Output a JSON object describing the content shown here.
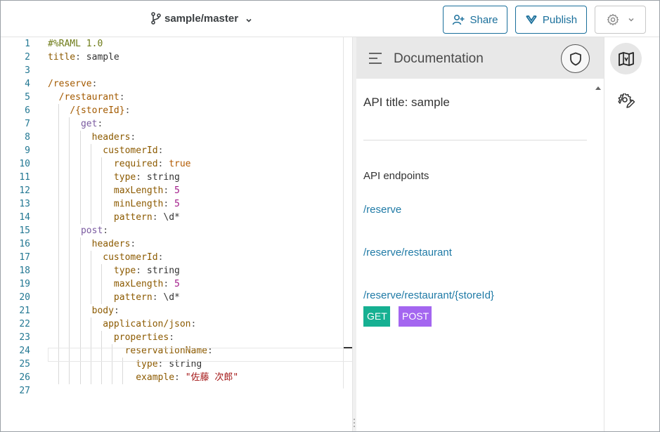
{
  "topbar": {
    "branch_label": "sample/master",
    "share_label": "Share",
    "publish_label": "Publish",
    "icons": {
      "branch": "git-branch-icon",
      "branch_dropdown": "chevron-down-icon",
      "share": "add-user-icon",
      "publish": "publish-icon",
      "settings": "gear-icon",
      "settings_dropdown": "chevron-down-icon"
    }
  },
  "editor": {
    "line_numbers": [
      "1",
      "2",
      "3",
      "4",
      "5",
      "6",
      "7",
      "8",
      "9",
      "10",
      "11",
      "12",
      "13",
      "14",
      "15",
      "16",
      "17",
      "18",
      "19",
      "20",
      "21",
      "22",
      "23",
      "24",
      "25",
      "26",
      "27"
    ],
    "lines": [
      "#%RAML 1.0",
      "title: sample",
      "",
      "/reserve:",
      "  /restaurant:",
      "    /{storeId}:",
      "      get:",
      "        headers:",
      "          customerId:",
      "            required: true",
      "            type: string",
      "            maxLength: 5",
      "            minLength: 5",
      "            pattern: \\d*",
      "      post:",
      "        headers:",
      "          customerId:",
      "            type: string",
      "            maxLength: 5",
      "            pattern: \\d*",
      "        body:",
      "          application/json:",
      "            properties:",
      "              reservationName:",
      "                type: string",
      "                example: \"佐藤 次郎\"",
      ""
    ],
    "colors": {
      "line_number": "#237893",
      "comment": "#6e7b18",
      "key": "#8c5a00",
      "bool": "#b35a00",
      "number": "#a21d8a"
    }
  },
  "docs": {
    "header_title": "Documentation",
    "api_title": "API title: sample",
    "endpoints_heading": "API endpoints",
    "endpoints": [
      "/reserve",
      "/reserve/restaurant",
      "/reserve/restaurant/{storeId}"
    ],
    "methods": [
      "GET",
      "POST"
    ],
    "icons": {
      "menu": "hamburger-menu-icon",
      "shield": "shield-icon"
    },
    "colors": {
      "link": "#1f7aa6",
      "get": "#16b092",
      "post": "#a466f0"
    }
  },
  "rail": {
    "icons": [
      "documentation-book-icon",
      "settings-gear-edit-icon"
    ]
  }
}
